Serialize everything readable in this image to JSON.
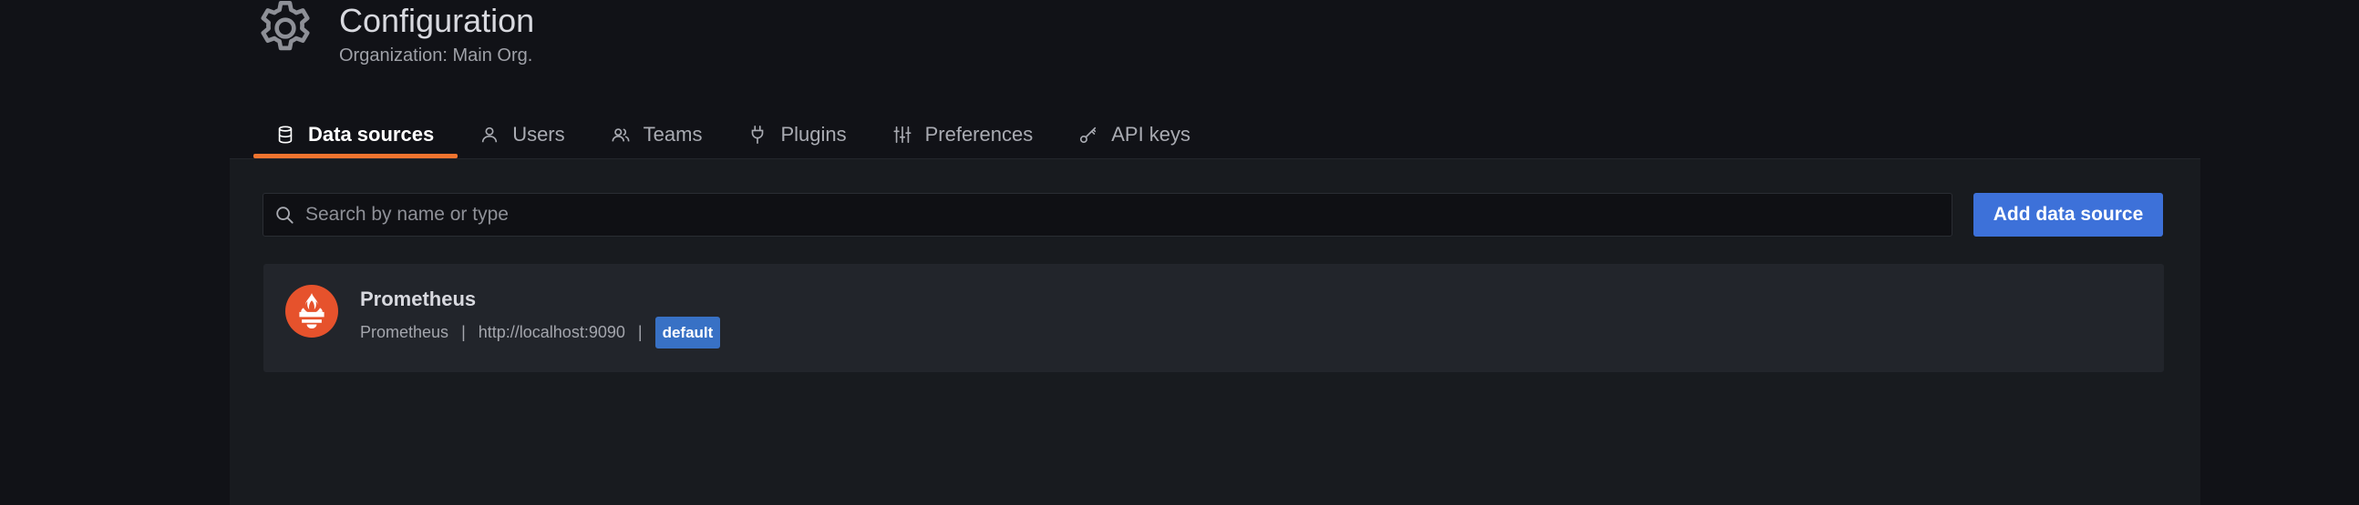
{
  "header": {
    "icon": "gear-icon",
    "title": "Configuration",
    "subtitle": "Organization: Main Org."
  },
  "tabs": [
    {
      "label": "Data sources",
      "icon": "database-icon",
      "active": true
    },
    {
      "label": "Users",
      "icon": "user-icon",
      "active": false
    },
    {
      "label": "Teams",
      "icon": "users-icon",
      "active": false
    },
    {
      "label": "Plugins",
      "icon": "plug-icon",
      "active": false
    },
    {
      "label": "Preferences",
      "icon": "sliders-icon",
      "active": false
    },
    {
      "label": "API keys",
      "icon": "key-icon",
      "active": false
    }
  ],
  "search": {
    "placeholder": "Search by name or type",
    "value": ""
  },
  "add_button_label": "Add data source",
  "datasource": {
    "name": "Prometheus",
    "type": "Prometheus",
    "separator": "|",
    "url": "http://localhost:9090",
    "badge": "default",
    "logo": "prometheus-logo"
  },
  "colors": {
    "background": "#111217",
    "panel": "#181b1f",
    "accent_tab": "#f0742f",
    "primary_button": "#3d71d9",
    "badge": "#3871c5",
    "prometheus": "#e6522c"
  }
}
